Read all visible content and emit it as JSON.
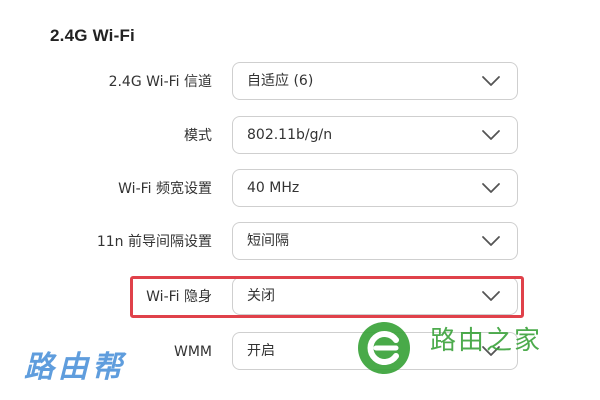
{
  "section": {
    "title": "2.4G Wi-Fi"
  },
  "settings": [
    {
      "label": "2.4G Wi-Fi 信道",
      "value": "自适应 (6)"
    },
    {
      "label": "模式",
      "value": "802.11b/g/n"
    },
    {
      "label": "Wi-Fi 频宽设置",
      "value": "40 MHz"
    },
    {
      "label": "11n 前导间隔设置",
      "value": "短间隔"
    },
    {
      "label": "Wi-Fi 隐身",
      "value": "关闭"
    },
    {
      "label": "WMM",
      "value": "开启"
    }
  ],
  "watermarks": {
    "left": "路由帮",
    "right": "路由之家"
  },
  "colors": {
    "highlight": "#e0414a",
    "watermark_blue": "#4a90d9",
    "watermark_green": "#3aa33a"
  },
  "icons": {
    "dropdown": "chevron-down-icon",
    "right_logo": "router-home-logo-icon"
  }
}
